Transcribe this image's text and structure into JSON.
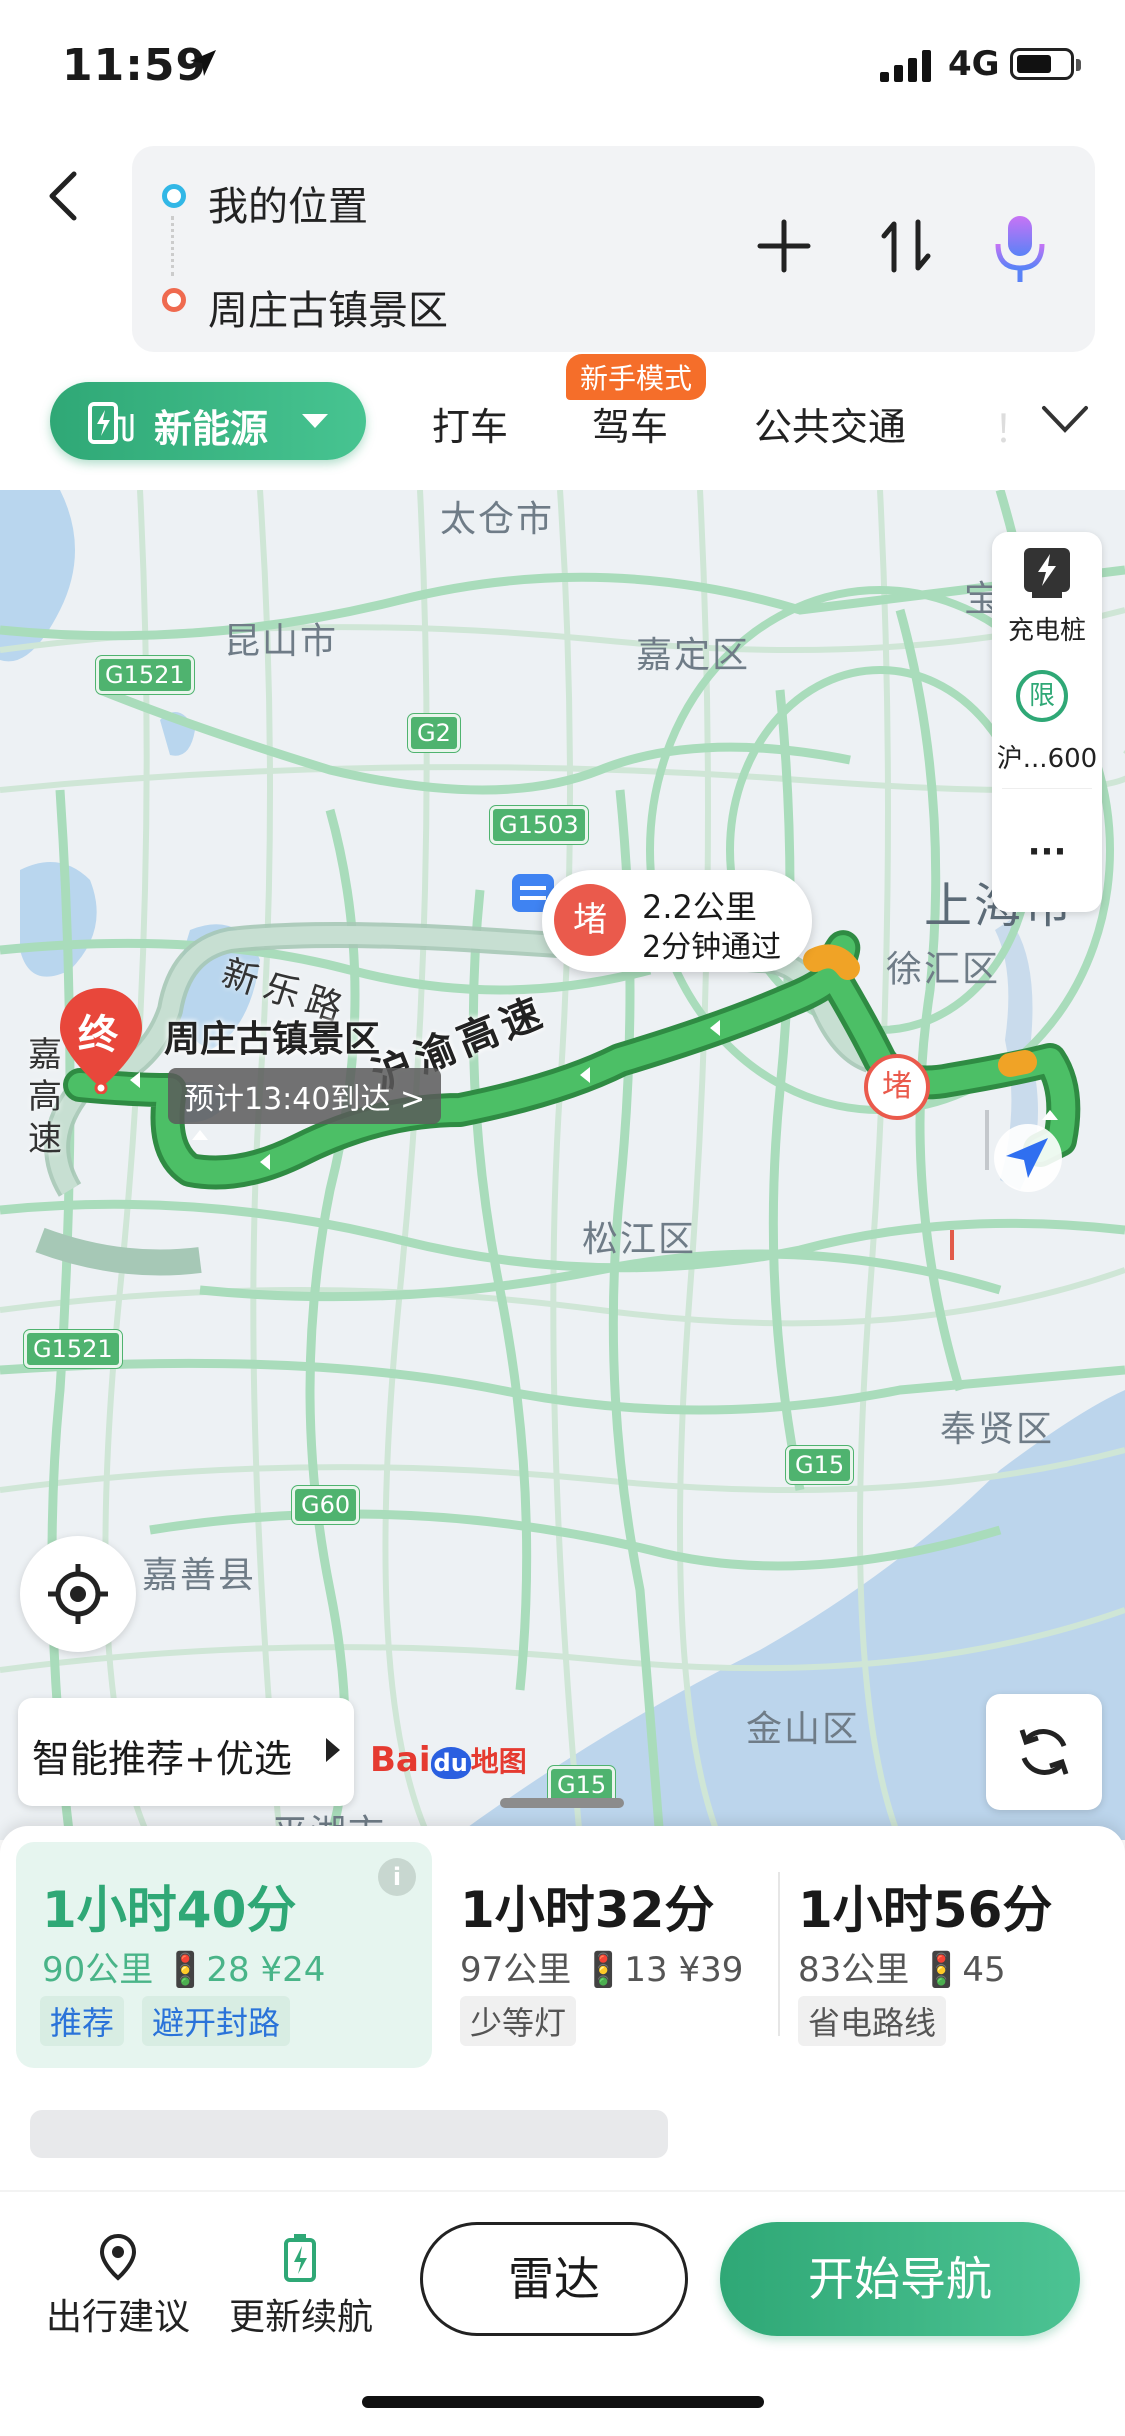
{
  "status_bar": {
    "time": "11:59",
    "network": "4G"
  },
  "route": {
    "from": "我的位置",
    "to": "周庄古镇景区"
  },
  "tabs": {
    "ev": "新能源",
    "taxi": "打车",
    "drive": "驾车",
    "drive_badge": "新手模式",
    "transit": "公共交通",
    "more": "！"
  },
  "map": {
    "districts": {
      "taicang": "太仓市",
      "kunshan": "昆山市",
      "jiading": "嘉定区",
      "shanghai": "上海市",
      "xuhui": "徐汇区",
      "songjiang": "松江区",
      "fengxian": "奉贤区",
      "jiashan": "嘉善县",
      "jinshan": "金山区",
      "pinghu": "平湖市",
      "bao": "宝"
    },
    "shields": {
      "g1521a": "G1521",
      "g2": "G2",
      "g1503": "G1503",
      "g1521b": "G1521",
      "g60": "G60",
      "g15a": "G15",
      "g15b": "G15"
    },
    "road_name": "沪渝高速",
    "road_xinle": "新乐路",
    "road_hujia": "嘉高速",
    "jam": {
      "icon": "堵",
      "distance": "2.2公里",
      "time": "2分钟通过"
    },
    "jam2_icon": "堵",
    "destination": {
      "pin": "终",
      "name": "周庄古镇景区",
      "eta": "预计13:40到达 >"
    },
    "side_panel": {
      "charging": "充电桩",
      "restrict_icon": "限",
      "restrict": "沪...600",
      "more": "···"
    },
    "smart_button": "智能推荐+优选",
    "logo": {
      "bai": "Bai",
      "du": "du",
      "ditu": "地图"
    }
  },
  "routes": [
    {
      "time": "1小时40分",
      "distance": "90公里",
      "lights": "28",
      "cost": "¥24",
      "tags": [
        "推荐",
        "避开封路"
      ]
    },
    {
      "time": "1小时32分",
      "distance": "97公里",
      "lights": "13",
      "cost": "¥39",
      "tags": [
        "少等灯"
      ]
    },
    {
      "time": "1小时56分",
      "distance": "83公里",
      "lights": "45",
      "cost": "",
      "tags": [
        "省电路线"
      ]
    }
  ],
  "info_icon": "i",
  "bottom": {
    "advice": "出行建议",
    "update": "更新续航",
    "radar": "雷达",
    "start": "开始导航"
  },
  "colors": {
    "accent": "#2fa876",
    "route": "#3fb05f",
    "jam": "#ea5a4c",
    "badge": "#f56e2a"
  }
}
